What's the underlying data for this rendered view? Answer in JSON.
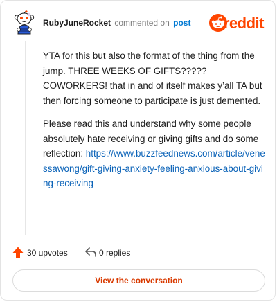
{
  "header": {
    "username": "RubyJuneRocket",
    "action_text": "commented on",
    "post_link": "post",
    "logo_text": "reddit"
  },
  "comment": {
    "paragraph1": "YTA for this but also the format of the thing from the jump. THREE WEEKS OF GIFTS????? COWORKERS! that in and of itself makes y’all TA but then forcing someone to participate is just demented.",
    "paragraph2": "Please read this and understand why some people absolutely hate receiving or giving gifts and do some reflection:",
    "link": "https://www.buzzfeednews.com/article/venessawong/gift-giving-anxiety-feeling-anxious-about-giving-receiving"
  },
  "actions": {
    "upvotes": "30 upvotes",
    "replies": "0 replies"
  },
  "cta": {
    "label": "View the conversation"
  },
  "colors": {
    "brand": "#ff4500",
    "link": "#0b63b8",
    "cta_text": "#d93a00"
  },
  "icons": {
    "avatar": "snoo-avatar-icon",
    "logo": "reddit-snoo-icon",
    "upvote": "upvote-arrow-icon",
    "reply": "reply-arrow-icon"
  }
}
